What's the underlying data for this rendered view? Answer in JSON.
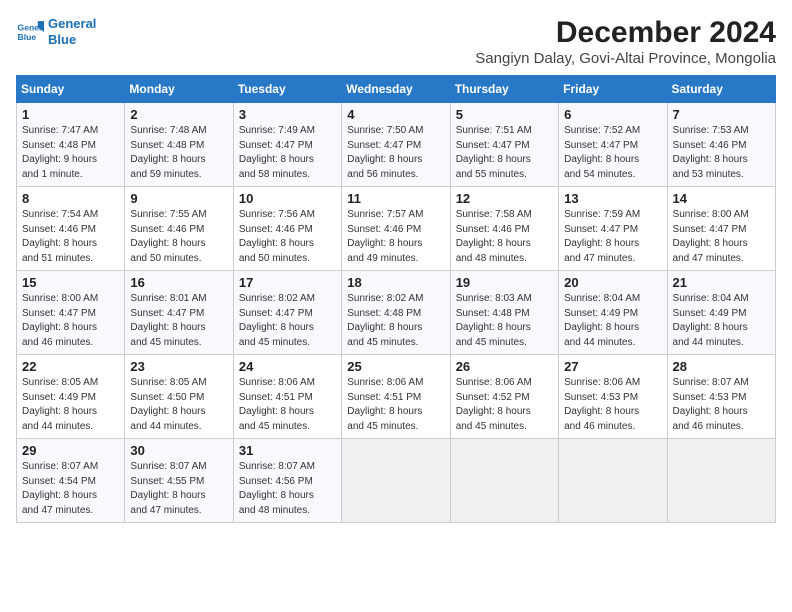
{
  "header": {
    "logo_line1": "General",
    "logo_line2": "Blue",
    "title": "December 2024",
    "subtitle": "Sangiyn Dalay, Govi-Altai Province, Mongolia"
  },
  "columns": [
    "Sunday",
    "Monday",
    "Tuesday",
    "Wednesday",
    "Thursday",
    "Friday",
    "Saturday"
  ],
  "weeks": [
    [
      {
        "day": "1",
        "info": "Sunrise: 7:47 AM\nSunset: 4:48 PM\nDaylight: 9 hours\nand 1 minute."
      },
      {
        "day": "2",
        "info": "Sunrise: 7:48 AM\nSunset: 4:48 PM\nDaylight: 8 hours\nand 59 minutes."
      },
      {
        "day": "3",
        "info": "Sunrise: 7:49 AM\nSunset: 4:47 PM\nDaylight: 8 hours\nand 58 minutes."
      },
      {
        "day": "4",
        "info": "Sunrise: 7:50 AM\nSunset: 4:47 PM\nDaylight: 8 hours\nand 56 minutes."
      },
      {
        "day": "5",
        "info": "Sunrise: 7:51 AM\nSunset: 4:47 PM\nDaylight: 8 hours\nand 55 minutes."
      },
      {
        "day": "6",
        "info": "Sunrise: 7:52 AM\nSunset: 4:47 PM\nDaylight: 8 hours\nand 54 minutes."
      },
      {
        "day": "7",
        "info": "Sunrise: 7:53 AM\nSunset: 4:46 PM\nDaylight: 8 hours\nand 53 minutes."
      }
    ],
    [
      {
        "day": "8",
        "info": "Sunrise: 7:54 AM\nSunset: 4:46 PM\nDaylight: 8 hours\nand 51 minutes."
      },
      {
        "day": "9",
        "info": "Sunrise: 7:55 AM\nSunset: 4:46 PM\nDaylight: 8 hours\nand 50 minutes."
      },
      {
        "day": "10",
        "info": "Sunrise: 7:56 AM\nSunset: 4:46 PM\nDaylight: 8 hours\nand 50 minutes."
      },
      {
        "day": "11",
        "info": "Sunrise: 7:57 AM\nSunset: 4:46 PM\nDaylight: 8 hours\nand 49 minutes."
      },
      {
        "day": "12",
        "info": "Sunrise: 7:58 AM\nSunset: 4:46 PM\nDaylight: 8 hours\nand 48 minutes."
      },
      {
        "day": "13",
        "info": "Sunrise: 7:59 AM\nSunset: 4:47 PM\nDaylight: 8 hours\nand 47 minutes."
      },
      {
        "day": "14",
        "info": "Sunrise: 8:00 AM\nSunset: 4:47 PM\nDaylight: 8 hours\nand 47 minutes."
      }
    ],
    [
      {
        "day": "15",
        "info": "Sunrise: 8:00 AM\nSunset: 4:47 PM\nDaylight: 8 hours\nand 46 minutes."
      },
      {
        "day": "16",
        "info": "Sunrise: 8:01 AM\nSunset: 4:47 PM\nDaylight: 8 hours\nand 45 minutes."
      },
      {
        "day": "17",
        "info": "Sunrise: 8:02 AM\nSunset: 4:47 PM\nDaylight: 8 hours\nand 45 minutes."
      },
      {
        "day": "18",
        "info": "Sunrise: 8:02 AM\nSunset: 4:48 PM\nDaylight: 8 hours\nand 45 minutes."
      },
      {
        "day": "19",
        "info": "Sunrise: 8:03 AM\nSunset: 4:48 PM\nDaylight: 8 hours\nand 45 minutes."
      },
      {
        "day": "20",
        "info": "Sunrise: 8:04 AM\nSunset: 4:49 PM\nDaylight: 8 hours\nand 44 minutes."
      },
      {
        "day": "21",
        "info": "Sunrise: 8:04 AM\nSunset: 4:49 PM\nDaylight: 8 hours\nand 44 minutes."
      }
    ],
    [
      {
        "day": "22",
        "info": "Sunrise: 8:05 AM\nSunset: 4:49 PM\nDaylight: 8 hours\nand 44 minutes."
      },
      {
        "day": "23",
        "info": "Sunrise: 8:05 AM\nSunset: 4:50 PM\nDaylight: 8 hours\nand 44 minutes."
      },
      {
        "day": "24",
        "info": "Sunrise: 8:06 AM\nSunset: 4:51 PM\nDaylight: 8 hours\nand 45 minutes."
      },
      {
        "day": "25",
        "info": "Sunrise: 8:06 AM\nSunset: 4:51 PM\nDaylight: 8 hours\nand 45 minutes."
      },
      {
        "day": "26",
        "info": "Sunrise: 8:06 AM\nSunset: 4:52 PM\nDaylight: 8 hours\nand 45 minutes."
      },
      {
        "day": "27",
        "info": "Sunrise: 8:06 AM\nSunset: 4:53 PM\nDaylight: 8 hours\nand 46 minutes."
      },
      {
        "day": "28",
        "info": "Sunrise: 8:07 AM\nSunset: 4:53 PM\nDaylight: 8 hours\nand 46 minutes."
      }
    ],
    [
      {
        "day": "29",
        "info": "Sunrise: 8:07 AM\nSunset: 4:54 PM\nDaylight: 8 hours\nand 47 minutes."
      },
      {
        "day": "30",
        "info": "Sunrise: 8:07 AM\nSunset: 4:55 PM\nDaylight: 8 hours\nand 47 minutes."
      },
      {
        "day": "31",
        "info": "Sunrise: 8:07 AM\nSunset: 4:56 PM\nDaylight: 8 hours\nand 48 minutes."
      },
      {
        "day": "",
        "info": ""
      },
      {
        "day": "",
        "info": ""
      },
      {
        "day": "",
        "info": ""
      },
      {
        "day": "",
        "info": ""
      }
    ]
  ]
}
